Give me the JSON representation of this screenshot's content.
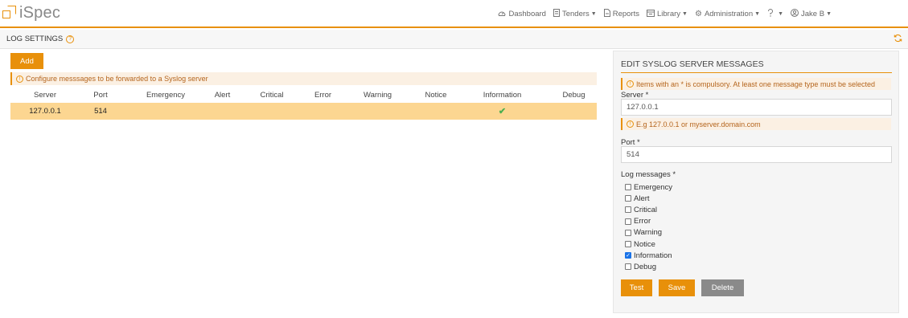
{
  "app": {
    "logo_text": "iSpec"
  },
  "nav": {
    "items": [
      {
        "label": "Dashboard",
        "icon": "gauge-icon",
        "caret": false
      },
      {
        "label": "Tenders",
        "icon": "document-icon",
        "caret": true
      },
      {
        "label": "Reports",
        "icon": "report-icon",
        "caret": false
      },
      {
        "label": "Library",
        "icon": "library-icon",
        "caret": true
      },
      {
        "label": "Administration",
        "icon": "gear-icon",
        "caret": true
      },
      {
        "label": "",
        "icon": "help-icon",
        "caret": true
      },
      {
        "label": "Jake B",
        "icon": "user-icon",
        "caret": true
      }
    ]
  },
  "page": {
    "title": "LOG SETTINGS"
  },
  "toolbar": {
    "add_label": "Add"
  },
  "list_info": "Configure messsages to be forwarded to a Syslog server",
  "table": {
    "columns": [
      "Server",
      "Port",
      "Emergency",
      "Alert",
      "Critical",
      "Error",
      "Warning",
      "Notice",
      "Information",
      "Debug"
    ],
    "rows": [
      {
        "server": "127.0.0.1",
        "port": "514",
        "emergency": false,
        "alert": false,
        "critical": false,
        "error": false,
        "warning": false,
        "notice": false,
        "information": true,
        "debug": false
      }
    ]
  },
  "edit_panel": {
    "title": "EDIT SYSLOG SERVER MESSAGES",
    "compulsory_info": "Items with an * is compulsory. At least one message type must be selected",
    "server_label": "Server *",
    "server_value": "127.0.0.1",
    "server_hint": "E.g 127.0.0.1 or myserver.domain.com",
    "port_label": "Port *",
    "port_value": "514",
    "log_messages_label": "Log messages *",
    "log_messages": [
      {
        "label": "Emergency",
        "checked": false
      },
      {
        "label": "Alert",
        "checked": false
      },
      {
        "label": "Critical",
        "checked": false
      },
      {
        "label": "Error",
        "checked": false
      },
      {
        "label": "Warning",
        "checked": false
      },
      {
        "label": "Notice",
        "checked": false
      },
      {
        "label": "Information",
        "checked": true
      },
      {
        "label": "Debug",
        "checked": false
      }
    ],
    "test_label": "Test",
    "save_label": "Save",
    "delete_label": "Delete"
  },
  "colors": {
    "accent": "#e8900a",
    "row_highlight": "#fcd691",
    "info_bg": "#fbf0e3",
    "delete_gray": "#8a8a8a",
    "tick_green": "#4caf50"
  }
}
